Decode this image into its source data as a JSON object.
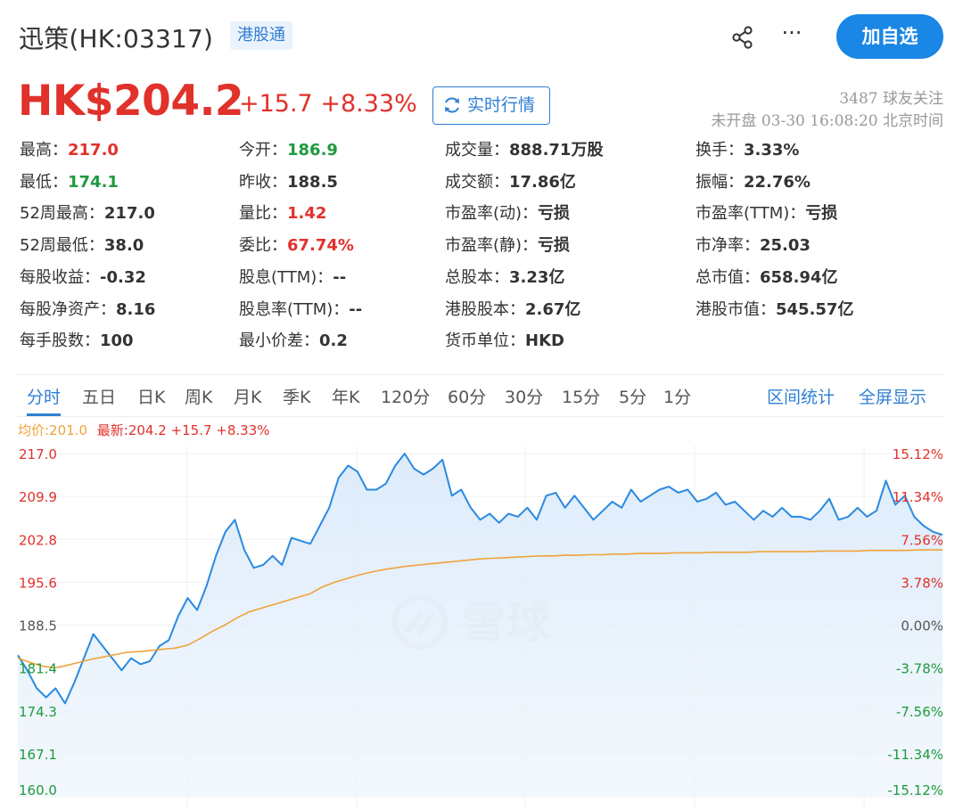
{
  "header": {
    "stock_name": "迅策(HK:03317)",
    "badge": "港股通",
    "share_icon": "share-icon",
    "more_label": "···",
    "follow_button": "加自选"
  },
  "price": {
    "current": "HK$204.2",
    "change": "+15.7 +8.33%",
    "realtime_button": "实时行情",
    "followers": "3487 球友关注",
    "status": "未开盘 03-30 16:08:20 北京时间"
  },
  "quote": [
    {
      "label": "最高：",
      "value": "217.0",
      "tone": "up"
    },
    {
      "label": "今开：",
      "value": "186.9",
      "tone": "down"
    },
    {
      "label": "成交量：",
      "value": "888.71万股",
      "tone": ""
    },
    {
      "label": "换手：",
      "value": "3.33%",
      "tone": ""
    },
    {
      "label": "最低：",
      "value": "174.1",
      "tone": "down"
    },
    {
      "label": "昨收：",
      "value": "188.5",
      "tone": ""
    },
    {
      "label": "成交额：",
      "value": "17.86亿",
      "tone": ""
    },
    {
      "label": "振幅：",
      "value": "22.76%",
      "tone": ""
    },
    {
      "label": "52周最高：",
      "value": "217.0",
      "tone": ""
    },
    {
      "label": "量比：",
      "value": "1.42",
      "tone": "up"
    },
    {
      "label": "市盈率(动)：",
      "value": "亏损",
      "tone": ""
    },
    {
      "label": "市盈率(TTM)：",
      "value": "亏损",
      "tone": ""
    },
    {
      "label": "52周最低：",
      "value": "38.0",
      "tone": ""
    },
    {
      "label": "委比：",
      "value": "67.74%",
      "tone": "up"
    },
    {
      "label": "市盈率(静)：",
      "value": "亏损",
      "tone": ""
    },
    {
      "label": "市净率：",
      "value": "25.03",
      "tone": ""
    },
    {
      "label": "每股收益：",
      "value": "-0.32",
      "tone": ""
    },
    {
      "label": "股息(TTM)：",
      "value": "--",
      "tone": ""
    },
    {
      "label": "总股本：",
      "value": "3.23亿",
      "tone": ""
    },
    {
      "label": "总市值：",
      "value": "658.94亿",
      "tone": ""
    },
    {
      "label": "每股净资产：",
      "value": "8.16",
      "tone": ""
    },
    {
      "label": "股息率(TTM)：",
      "value": "--",
      "tone": ""
    },
    {
      "label": "港股股本：",
      "value": "2.67亿",
      "tone": ""
    },
    {
      "label": "港股市值：",
      "value": "545.57亿",
      "tone": ""
    },
    {
      "label": "每手股数：",
      "value": "100",
      "tone": ""
    },
    {
      "label": "最小价差：",
      "value": "0.2",
      "tone": ""
    },
    {
      "label": "货币单位：",
      "value": "HKD",
      "tone": ""
    }
  ],
  "tabs": [
    "分时",
    "五日",
    "日K",
    "周K",
    "月K",
    "季K",
    "年K",
    "120分",
    "60分",
    "30分",
    "15分",
    "5分",
    "1分"
  ],
  "tab_links": [
    "区间统计",
    "全屏显示"
  ],
  "legend": {
    "avg": "均价:201.0",
    "latest": "最新:204.2 +15.7 +8.33%"
  },
  "watermark": "雪球",
  "colors": {
    "up": "#e0312b",
    "down": "#1e9a3e",
    "price_line": "#2a8ae0",
    "avg_line": "#f0a23a",
    "accent": "#1a86e6"
  },
  "chart_data": {
    "type": "line",
    "title": "",
    "xlabel": "",
    "ylabel": "",
    "ylim": [
      160.0,
      217.0
    ],
    "yticks_left": [
      "217.0",
      "209.9",
      "202.8",
      "195.6",
      "188.5",
      "181.4",
      "174.3",
      "167.1",
      "160.0"
    ],
    "yticks_right": [
      "15.12%",
      "11.34%",
      "7.56%",
      "3.78%",
      "0.00%",
      "-3.78%",
      "-7.56%",
      "-11.34%",
      "-15.12%"
    ],
    "grid": true,
    "series": [
      {
        "role": "price",
        "values": [
          183.5,
          181,
          178,
          176.5,
          178,
          175.5,
          179,
          183,
          187,
          185,
          183,
          181,
          183,
          182,
          182.5,
          185,
          186,
          190,
          193,
          191,
          195,
          200,
          204,
          206,
          201,
          198,
          198.5,
          200,
          198.5,
          203,
          202.5,
          202,
          205,
          208,
          213,
          215,
          214,
          211,
          211,
          212,
          215,
          217,
          214.5,
          213.5,
          214.5,
          216,
          210,
          211,
          208,
          206,
          207,
          205.5,
          207,
          206.5,
          208,
          206,
          210,
          210.5,
          208,
          210,
          208,
          206,
          207.5,
          209,
          208,
          211,
          209,
          210,
          211,
          211.5,
          210.5,
          211,
          209,
          209.5,
          210.5,
          208.5,
          209,
          207.5,
          206,
          207.5,
          206.5,
          208,
          206.5,
          206.5,
          206,
          207.5,
          209.5,
          206,
          206.5,
          208,
          206.5,
          207.5,
          212.5,
          208.5,
          210,
          206.5,
          205,
          204,
          203.5
        ]
      },
      {
        "role": "average",
        "values": [
          183,
          182.3,
          181.7,
          181.4,
          181.8,
          182.3,
          182.8,
          183.2,
          183.6,
          184,
          184.1,
          184.3,
          184.5,
          184.7,
          185.2,
          186.3,
          187.5,
          188.5,
          189.7,
          190.7,
          191.3,
          191.9,
          192.5,
          193.1,
          193.7,
          194.8,
          195.6,
          196.2,
          196.8,
          197.3,
          197.7,
          198,
          198.3,
          198.5,
          198.7,
          198.9,
          199.1,
          199.3,
          199.5,
          199.6,
          199.7,
          199.8,
          199.9,
          200,
          200,
          200.1,
          200.1,
          200.2,
          200.2,
          200.3,
          200.3,
          200.4,
          200.4,
          200.4,
          200.5,
          200.5,
          200.5,
          200.6,
          200.6,
          200.6,
          200.6,
          200.7,
          200.7,
          200.7,
          200.7,
          200.7,
          200.8,
          200.8,
          200.8,
          200.8,
          200.9,
          200.9,
          200.9,
          200.9,
          201,
          201,
          201
        ]
      }
    ]
  }
}
